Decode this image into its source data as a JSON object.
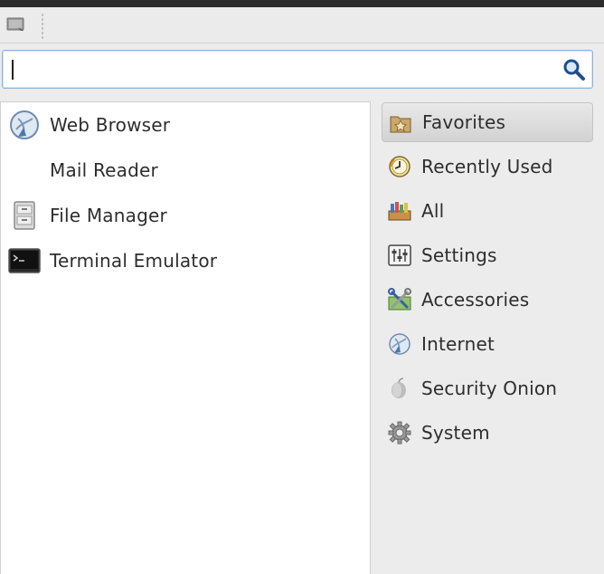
{
  "search": {
    "value": "",
    "placeholder": ""
  },
  "apps": [
    {
      "label": "Web Browser",
      "icon": "globe-icon"
    },
    {
      "label": "Mail Reader",
      "icon": ""
    },
    {
      "label": "File Manager",
      "icon": "file-cabinet-icon"
    },
    {
      "label": "Terminal Emulator",
      "icon": "terminal-icon"
    }
  ],
  "categories": [
    {
      "label": "Favorites",
      "icon": "favorites-folder-icon",
      "selected": true
    },
    {
      "label": "Recently Used",
      "icon": "clock-icon"
    },
    {
      "label": "All",
      "icon": "all-apps-icon"
    },
    {
      "label": "Settings",
      "icon": "settings-icon"
    },
    {
      "label": "Accessories",
      "icon": "accessories-icon"
    },
    {
      "label": "Internet",
      "icon": "internet-icon"
    },
    {
      "label": "Security Onion",
      "icon": "onion-icon"
    },
    {
      "label": "System",
      "icon": "gear-icon"
    }
  ],
  "colors": {
    "search_border": "#8fb3d9",
    "selected_category": "#d6d6d6",
    "topbar": "#2b2b2b"
  }
}
